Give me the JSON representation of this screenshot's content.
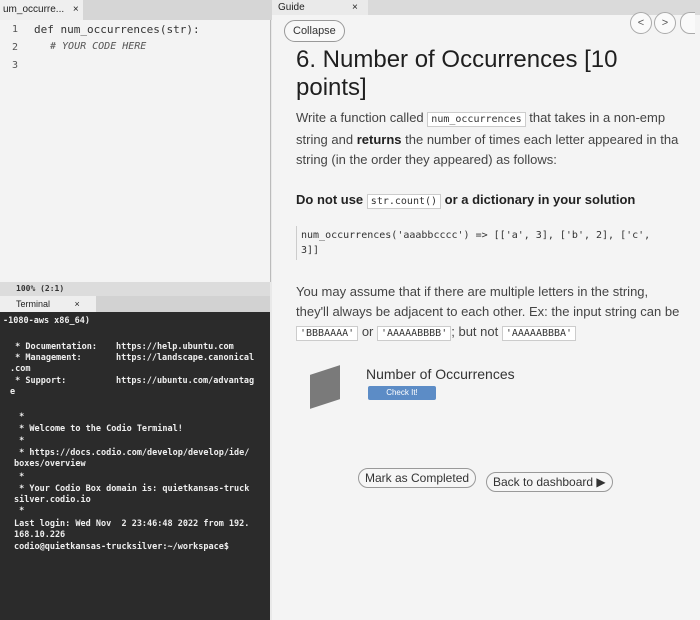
{
  "editor": {
    "tab_label": "um_occurre...",
    "tab_close": "×",
    "lines": [
      {
        "num": "1",
        "text": "def num_occurrences(str):"
      },
      {
        "num": "2",
        "text": "# YOUR CODE HERE"
      },
      {
        "num": "3",
        "text": ""
      }
    ],
    "status": "100% (2:1)"
  },
  "terminal": {
    "tab_label": "Terminal",
    "tab_close": "×",
    "lines": [
      "-1080-aws x86_64)",
      " * Documentation:",
      " * Management:",
      ".com",
      " * Support:",
      "e",
      " *",
      " * Welcome to the Codio Terminal!",
      " *",
      " * https://docs.codio.com/develop/develop/ide/",
      "boxes/overview",
      " *",
      " * Your Codio Box domain is: quietkansas-truck",
      "silver.codio.io",
      " *",
      "Last login: Wed Nov  2 23:46:48 2022 from 192.",
      "168.10.226",
      "codio@quietkansas-trucksilver:~/workspace$"
    ],
    "links": [
      "https://help.ubuntu.com",
      "https://landscape.canonical",
      "https://ubuntu.com/advantag"
    ]
  },
  "guide": {
    "tab_label": "Guide",
    "tab_close": "×",
    "collapse": "Collapse",
    "prev": "<",
    "next": ">",
    "title": "6. Number of Occurrences [10 points]",
    "intro_1": "Write a function called",
    "func_name": "num_occurrences",
    "intro_2": "that takes in a non-emp",
    "intro_3": "string and",
    "intro_returns": "returns",
    "intro_4": "the number of times each letter appeared in tha",
    "intro_5": "string (in the order they appeared) as follows:",
    "warn_1": "Do not use",
    "warn_code": "str.count()",
    "warn_2": "or a dictionary in your solution",
    "example_1": "num_occurrences('aaabbcccc') => [['a', 3], ['b', 2], ['c',",
    "example_2": "3]]",
    "assume_1": "You may assume that if there are multiple letters in the string,",
    "assume_2": "they'll always be adjacent to each other. Ex: the input string can be",
    "ex_a": "'BBBAAAA'",
    "or": "or",
    "ex_b": "'AAAAABBBB'",
    "but_not": "; but not",
    "ex_c": "'AAAAABBBA'",
    "quiz_title": "Number of Occurrences",
    "check": "Check It!",
    "mark_complete": "Mark as Completed",
    "back": "Back to dashboard ▶"
  }
}
